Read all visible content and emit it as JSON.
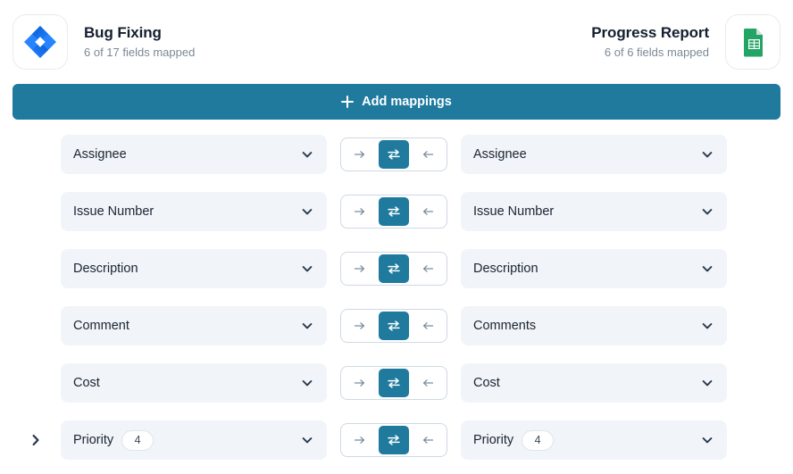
{
  "header": {
    "left": {
      "icon": "jira-logo",
      "title": "Bug Fixing",
      "subtitle": "6 of 17 fields mapped"
    },
    "right": {
      "icon": "google-sheets-logo",
      "title": "Progress Report",
      "subtitle": "6 of 6 fields mapped"
    }
  },
  "toolbar": {
    "add_mappings_label": "Add mappings",
    "add_icon": "plus-icon",
    "accent_color": "#1f7a9e"
  },
  "direction_options": {
    "right": "to-right-arrow-icon",
    "both": "two-way-sync-icon",
    "left": "to-left-arrow-icon"
  },
  "colors": {
    "accent": "#1f7a9e",
    "field_bg": "#f1f4f8",
    "text": "#1b2533",
    "muted_text": "#7b8897",
    "jira_blue": "#2684ff",
    "sheets_green": "#23a566"
  },
  "mappings": [
    {
      "left": {
        "label": "Assignee",
        "badge": null
      },
      "direction": "both",
      "right": {
        "label": "Assignee",
        "badge": null
      },
      "expandable": false
    },
    {
      "left": {
        "label": "Issue Number",
        "badge": null
      },
      "direction": "both",
      "right": {
        "label": "Issue Number",
        "badge": null
      },
      "expandable": false
    },
    {
      "left": {
        "label": "Description",
        "badge": null
      },
      "direction": "both",
      "right": {
        "label": "Description",
        "badge": null
      },
      "expandable": false
    },
    {
      "left": {
        "label": "Comment",
        "badge": null
      },
      "direction": "both",
      "right": {
        "label": "Comments",
        "badge": null
      },
      "expandable": false
    },
    {
      "left": {
        "label": "Cost",
        "badge": null
      },
      "direction": "both",
      "right": {
        "label": "Cost",
        "badge": null
      },
      "expandable": false
    },
    {
      "left": {
        "label": "Priority",
        "badge": "4"
      },
      "direction": "both",
      "right": {
        "label": "Priority",
        "badge": "4"
      },
      "expandable": true
    }
  ]
}
